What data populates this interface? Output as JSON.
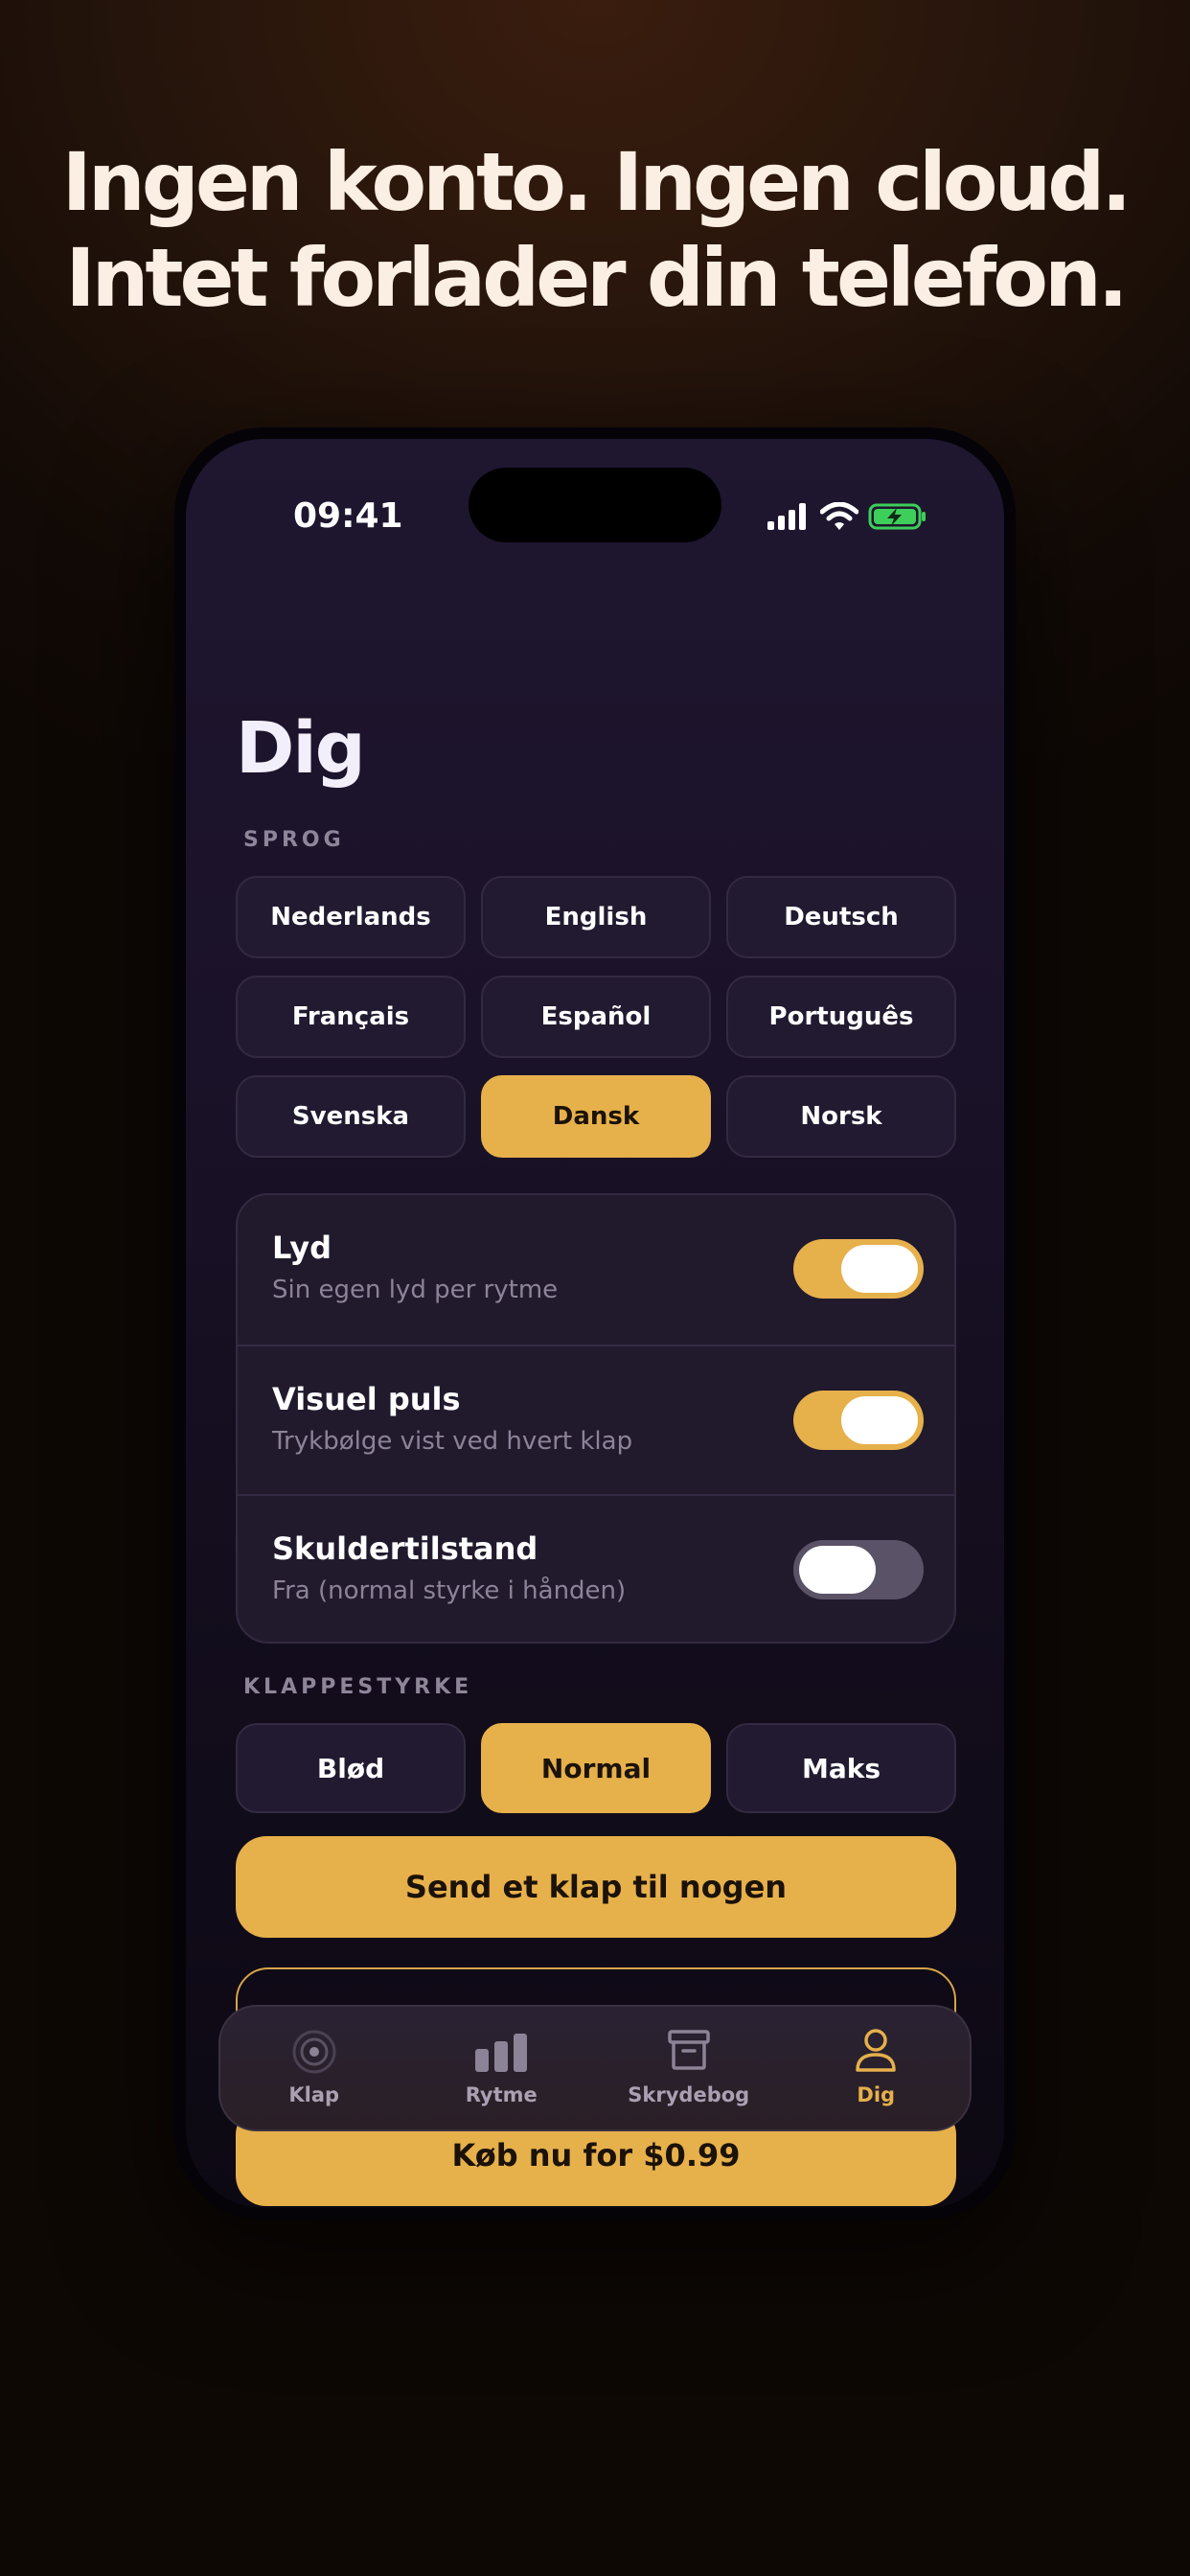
{
  "headline": {
    "line1": "Ingen konto. Ingen cloud.",
    "line2": "Intet forlader din telefon."
  },
  "status_bar": {
    "time": "09:41",
    "icons": [
      "cellular-signal-icon",
      "wifi-icon",
      "battery-charging-icon"
    ],
    "battery_color": "#3ccf5a"
  },
  "page": {
    "title": "Dig"
  },
  "language": {
    "label": "SPROG",
    "options": [
      "Nederlands",
      "English",
      "Deutsch",
      "Français",
      "Español",
      "Português",
      "Svenska",
      "Dansk",
      "Norsk"
    ],
    "selected": "Dansk"
  },
  "settings": [
    {
      "title": "Lyd",
      "subtitle": "Sin egen lyd per rytme",
      "enabled": true
    },
    {
      "title": "Visuel puls",
      "subtitle": "Trykbølge vist ved hvert klap",
      "enabled": true
    },
    {
      "title": "Skuldertilstand",
      "subtitle": "Fra (normal styrke i hånden)",
      "enabled": false
    }
  ],
  "strength": {
    "label": "KLAPPESTYRKE",
    "options": [
      "Blød",
      "Normal",
      "Maks"
    ],
    "selected": "Normal"
  },
  "send_button": {
    "label": "Send et klap til nogen"
  },
  "buy_button": {
    "label": "Køb nu for $0.99"
  },
  "tabbar": {
    "tabs": [
      {
        "label": "Klap",
        "icon": "radar-icon"
      },
      {
        "label": "Rytme",
        "icon": "bar-chart-icon"
      },
      {
        "label": "Skrydebog",
        "icon": "archive-box-icon"
      },
      {
        "label": "Dig",
        "icon": "person-icon"
      }
    ],
    "active": "Dig"
  },
  "colors": {
    "accent": "#e6b04b",
    "background_top": "#3a1d0e",
    "screen_bg": "#1a1228",
    "card_bg": "#211a2d",
    "muted_text": "#8d8399"
  }
}
